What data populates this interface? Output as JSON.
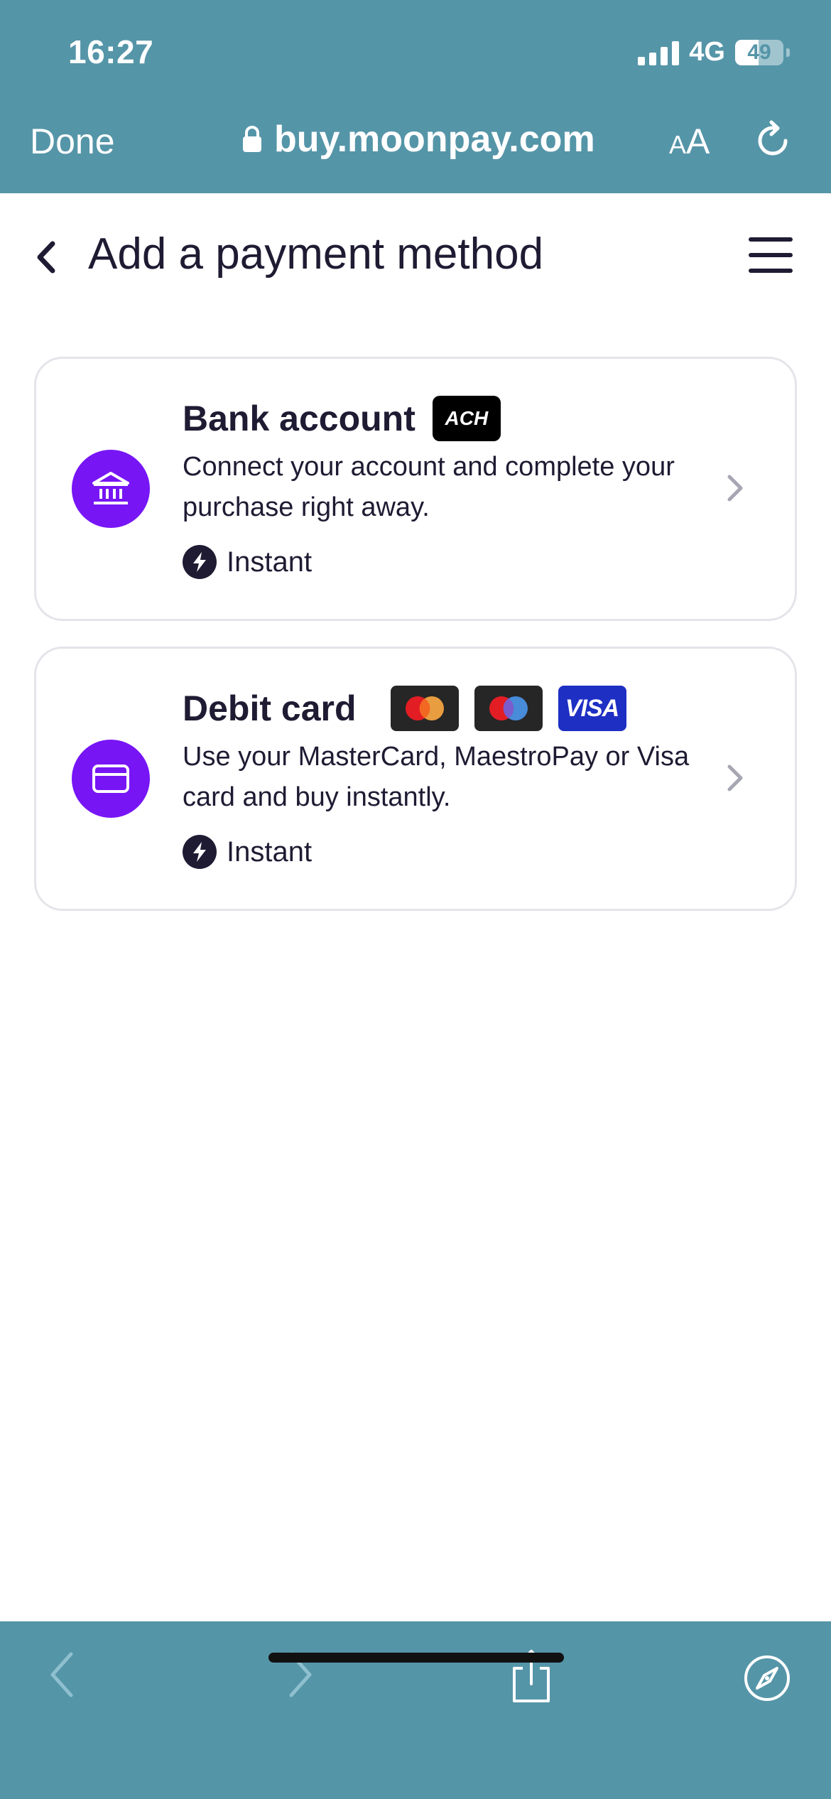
{
  "status_bar": {
    "time": "16:27",
    "network": "4G",
    "battery": "49"
  },
  "browser": {
    "done_label": "Done",
    "url": "buy.moonpay.com",
    "text_size_small": "A",
    "text_size_large": "A"
  },
  "header": {
    "title": "Add a payment method"
  },
  "cards": [
    {
      "title": "Bank account",
      "badge": "ACH",
      "description": "Connect your account and complete your purchase right away.",
      "speed": "Instant"
    },
    {
      "title": "Debit card",
      "logos": [
        "mastercard-logo",
        "maestro-logo",
        "visa-logo"
      ],
      "visa_text": "VISA",
      "description": "Use your MasterCard, MaestroPay or Visa card and buy instantly.",
      "speed": "Instant"
    }
  ],
  "colors": {
    "chrome": "#5595a8",
    "accent": "#7715f5",
    "text": "#1f1b33",
    "card_border": "#e4e4ea"
  }
}
